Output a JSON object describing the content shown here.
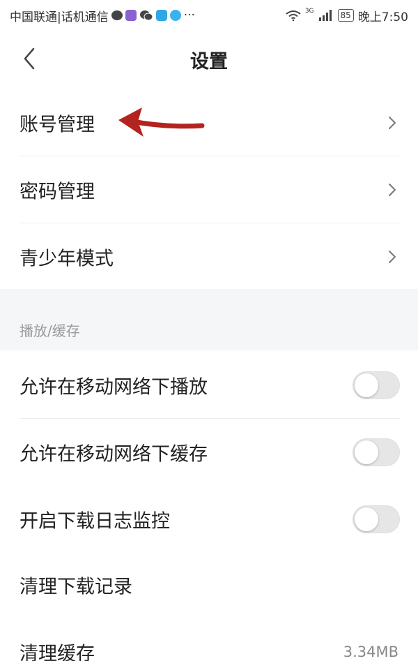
{
  "status_bar": {
    "carrier": "中国联通|话机通信",
    "more": "···",
    "network": "3G",
    "battery": "85",
    "time": "晚上7:50"
  },
  "header": {
    "title": "设置",
    "back_icon": "chevron-left-icon"
  },
  "account_rows": [
    {
      "label": "账号管理"
    },
    {
      "label": "密码管理"
    },
    {
      "label": "青少年模式"
    }
  ],
  "section": {
    "label": "播放/缓存"
  },
  "toggle_rows": [
    {
      "label": "允许在移动网络下播放",
      "on": false
    },
    {
      "label": "允许在移动网络下缓存",
      "on": false
    },
    {
      "label": "开启下载日志监控",
      "on": false
    }
  ],
  "plain_rows": [
    {
      "label": "清理下载记录"
    },
    {
      "label": "清理缓存",
      "value": "3.34MB"
    }
  ],
  "colors": {
    "annotation_arrow": "#b3231f",
    "section_bg": "#f5f6f8",
    "toggle_off": "#e6e6e6"
  }
}
